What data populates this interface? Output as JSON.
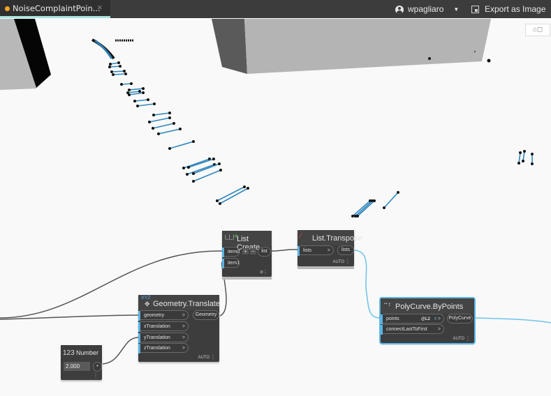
{
  "tab": {
    "title": "NoiseComplaintPoin...",
    "modified": true,
    "close_icon": "×"
  },
  "header": {
    "user": "wpagliaro",
    "export_label": "Export as Image"
  },
  "view_toggle": {
    "icon": "geometry-view-toggle"
  },
  "nodes": {
    "list_create": {
      "title": "List Create",
      "inputs": [
        "item0",
        "item1"
      ],
      "output": "list",
      "add": "+",
      "remove": "−"
    },
    "list_transpose": {
      "title": "List.Transpose",
      "inputs": [
        "lists"
      ],
      "output": "lists",
      "lacing": "AUTO"
    },
    "geometry_translate": {
      "title": "Geometry.Translate",
      "category_tag": "XYZ",
      "inputs": [
        "geometry",
        "xTranslation",
        "yTranslation",
        "zTranslation"
      ],
      "output": "Geometry",
      "lacing": "AUTO"
    },
    "number": {
      "title": "Number",
      "category_tag": "123",
      "value": "2.000"
    },
    "polycurve_bypoints": {
      "title": "PolyCurve.ByPoints",
      "inputs": [
        "points",
        "connectLastToFirst"
      ],
      "list_level": "@L2",
      "output": "PolyCurve",
      "lacing": "AUTO"
    }
  },
  "colors": {
    "accent": "#5ab3e5",
    "wire_selected": "#6ec3ea",
    "node_body": "#3d3d3d",
    "topbar": "#3c3c3c",
    "tab_underline": "#a9e4dd",
    "modified_dot": "#f5a623"
  }
}
